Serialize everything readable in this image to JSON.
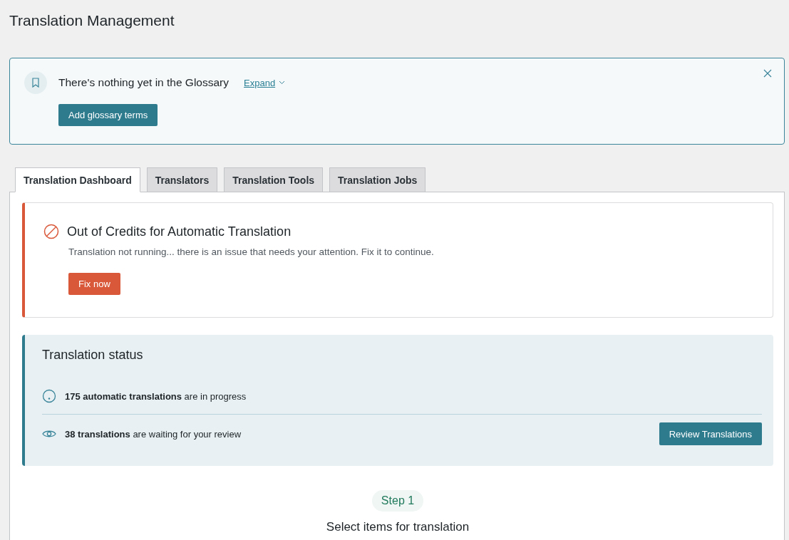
{
  "page_title": "Translation Management",
  "glossary_notice": {
    "message": "There's nothing yet in the Glossary",
    "expand_link": "Expand",
    "button": "Add glossary terms"
  },
  "tabs": [
    {
      "label": "Translation Dashboard",
      "selected": true
    },
    {
      "label": "Translators",
      "selected": false
    },
    {
      "label": "Translation Tools",
      "selected": false
    },
    {
      "label": "Translation Jobs",
      "selected": false
    }
  ],
  "alert": {
    "title": "Out of Credits for Automatic Translation",
    "message": "Translation not running... there is an issue that needs your attention. Fix it to continue.",
    "button": "Fix now"
  },
  "translation_status": {
    "title": "Translation status",
    "rows": [
      {
        "kind": "progress",
        "text": "**175 automatic translations** are in progress"
      },
      {
        "kind": "review",
        "text": "**38 translations** are waiting for your review",
        "button": "Review Translations"
      }
    ]
  },
  "step": {
    "badge": "Step 1",
    "title": "Select items for translation"
  }
}
